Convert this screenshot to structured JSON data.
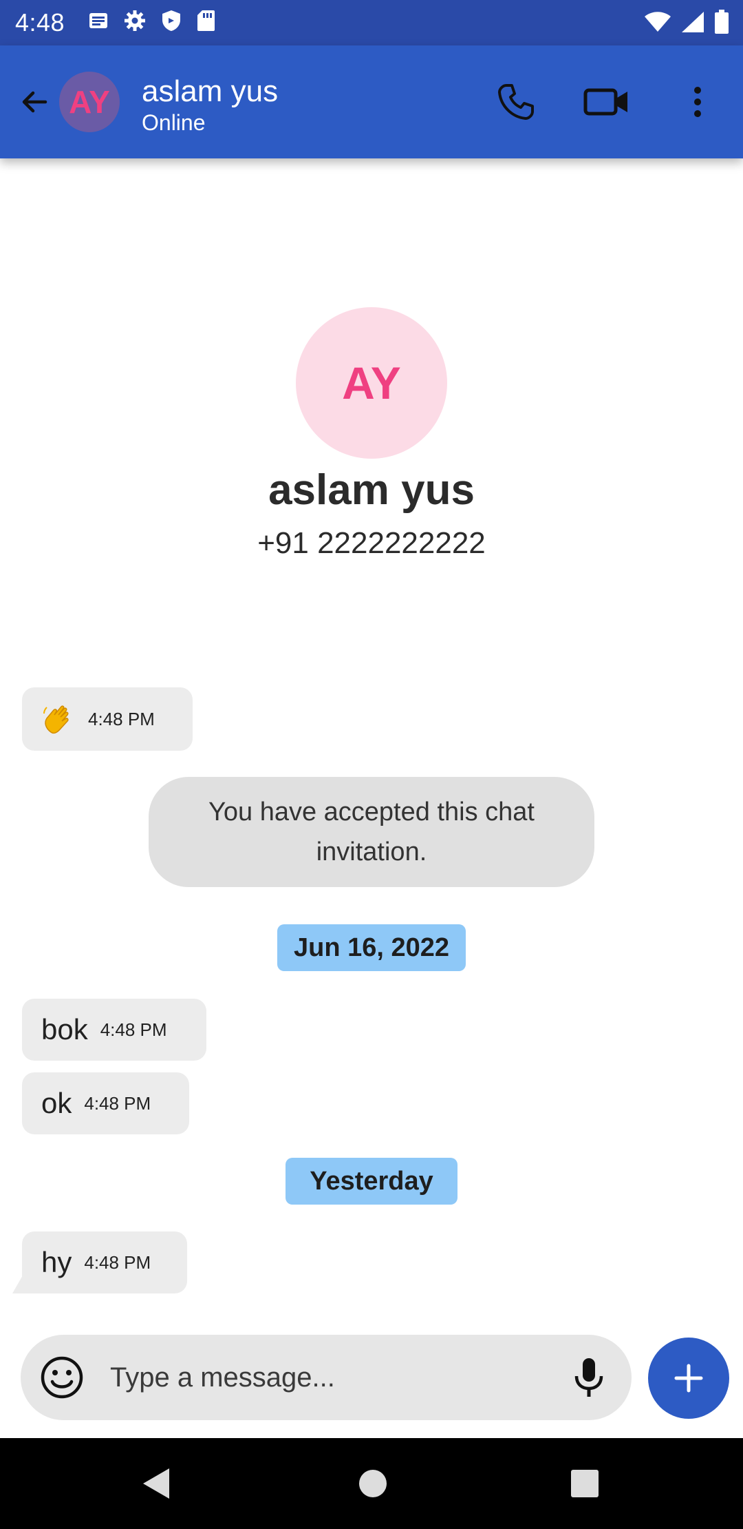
{
  "status_bar": {
    "time": "4:48",
    "icons_left": [
      "news-icon",
      "settings-icon",
      "shield-icon",
      "sd-card-icon"
    ],
    "icons_right": [
      "wifi-icon",
      "signal-icon",
      "battery-icon"
    ]
  },
  "header": {
    "avatar_initials": "AY",
    "name": "aslam yus",
    "status": "Online",
    "icons": [
      "back-arrow-icon",
      "phone-icon",
      "video-camera-icon",
      "more-vert-icon"
    ]
  },
  "contact": {
    "initials": "AY",
    "name": "aslam yus",
    "phone": "+91 2222222222"
  },
  "messages": {
    "wave": {
      "emoji": "👋",
      "time": "4:48 PM"
    },
    "system_text": "You have accepted this chat invitation.",
    "date_chip_1": "Jun 16, 2022",
    "bok": {
      "text": "bok",
      "time": "4:48 PM"
    },
    "ok": {
      "text": "ok",
      "time": "4:48 PM"
    },
    "date_chip_2": "Yesterday",
    "hy": {
      "text": "hy",
      "time": "4:48 PM"
    }
  },
  "composer": {
    "placeholder": "Type a message...",
    "icons": [
      "emoji-icon",
      "mic-icon",
      "plus-icon"
    ]
  },
  "colors": {
    "status_bar": "#2a4aa8",
    "app_bar": "#2d5bc4",
    "avatar_text": "#ef4081",
    "contact_avatar_bg": "#fcdbe6",
    "date_chip": "#8ec8f7",
    "bubble": "#ececec"
  }
}
